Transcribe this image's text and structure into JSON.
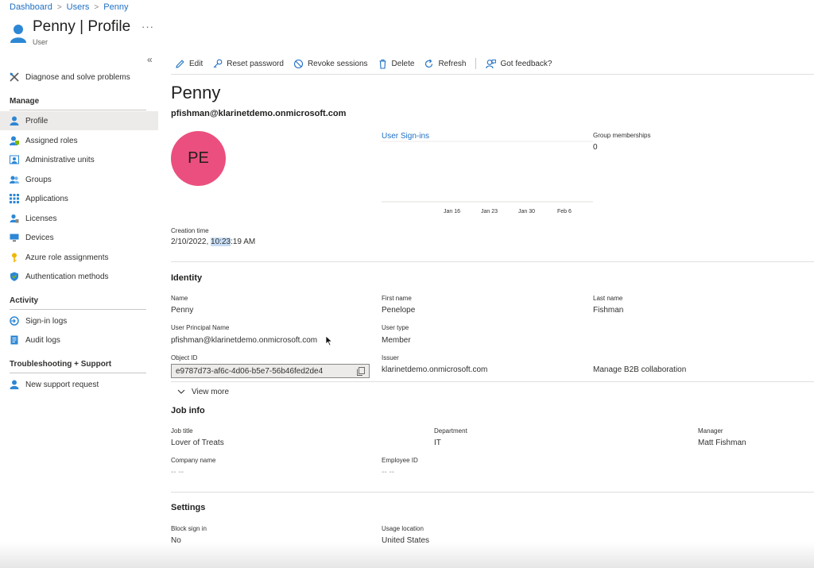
{
  "breadcrumb": [
    "Dashboard",
    "Users",
    "Penny"
  ],
  "header": {
    "title": "Penny | Profile",
    "subtitle": "User",
    "more": "···"
  },
  "sidebar": {
    "collapse_icon": "«",
    "diagnose": "Diagnose and solve problems",
    "sections": {
      "manage": "Manage",
      "activity": "Activity",
      "support": "Troubleshooting + Support"
    },
    "manage_items": [
      {
        "label": "Profile",
        "icon": "user-icon"
      },
      {
        "label": "Assigned roles",
        "icon": "roles-icon"
      },
      {
        "label": "Administrative units",
        "icon": "admin-units-icon"
      },
      {
        "label": "Groups",
        "icon": "groups-icon"
      },
      {
        "label": "Applications",
        "icon": "applications-icon"
      },
      {
        "label": "Licenses",
        "icon": "licenses-icon"
      },
      {
        "label": "Devices",
        "icon": "devices-icon"
      },
      {
        "label": "Azure role assignments",
        "icon": "key-icon"
      },
      {
        "label": "Authentication methods",
        "icon": "shield-icon"
      }
    ],
    "activity_items": [
      {
        "label": "Sign-in logs",
        "icon": "signin-icon"
      },
      {
        "label": "Audit logs",
        "icon": "audit-icon"
      }
    ],
    "support_items": [
      {
        "label": "New support request",
        "icon": "support-icon"
      }
    ]
  },
  "toolbar": {
    "edit": "Edit",
    "reset_password": "Reset password",
    "revoke_sessions": "Revoke sessions",
    "delete": "Delete",
    "refresh": "Refresh",
    "feedback": "Got feedback?"
  },
  "profile": {
    "display_name": "Penny",
    "upn": "pfishman@klarinetdemo.onmicrosoft.com",
    "initials": "PE",
    "signins_label": "User Sign-ins",
    "group_memberships_label": "Group memberships",
    "group_memberships_value": "0",
    "chart_ticks": [
      "Jan 16",
      "Jan 23",
      "Jan 30",
      "Feb 6"
    ],
    "creation_time_label": "Creation time",
    "creation_time_date": "2/10/2022, ",
    "creation_time_highlight": "10:23",
    "creation_time_rest": ":19 AM"
  },
  "identity": {
    "title": "Identity",
    "name_label": "Name",
    "name": "Penny",
    "first_name_label": "First name",
    "first_name": "Penelope",
    "last_name_label": "Last name",
    "last_name": "Fishman",
    "upn_label": "User Principal Name",
    "upn": "pfishman@klarinetdemo.onmicrosoft.com",
    "user_type_label": "User type",
    "user_type": "Member",
    "object_id_label": "Object ID",
    "object_id": "e9787d73-af6c-4d06-b5e7-56b46fed2de4",
    "issuer_label": "Issuer",
    "issuer": "klarinetdemo.onmicrosoft.com",
    "b2b": "Manage B2B collaboration",
    "view_more": "View more"
  },
  "job": {
    "title": "Job info",
    "job_title_label": "Job title",
    "job_title": "Lover of Treats",
    "department_label": "Department",
    "department": "IT",
    "manager_label": "Manager",
    "manager": "Matt Fishman",
    "company_label": "Company name",
    "company": "-- --",
    "employee_id_label": "Employee ID",
    "employee_id": "-- --"
  },
  "settings": {
    "title": "Settings",
    "block_label": "Block sign in",
    "block": "No",
    "usage_label": "Usage location",
    "usage": "United States"
  }
}
